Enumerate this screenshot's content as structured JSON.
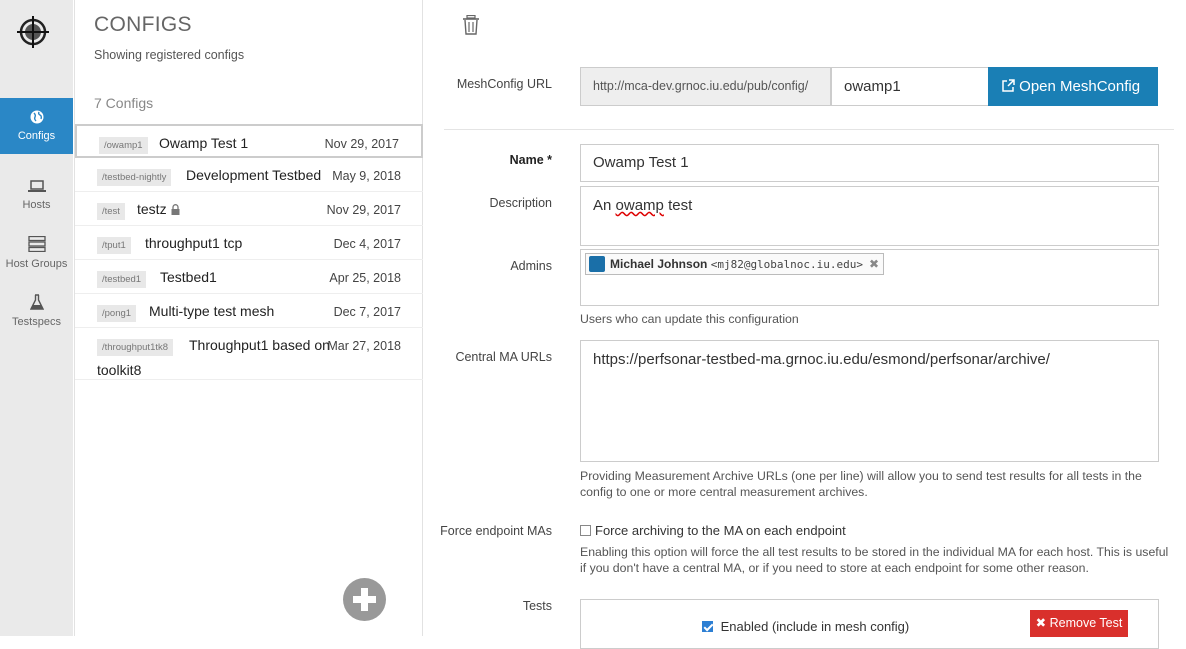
{
  "nav": {
    "items": [
      {
        "label": "Configs",
        "icon": "globe-icon",
        "active": true
      },
      {
        "label": "Hosts",
        "icon": "laptop-icon",
        "active": false
      },
      {
        "label": "Host Groups",
        "icon": "server-icon",
        "active": false
      },
      {
        "label": "Testspecs",
        "icon": "flask-icon",
        "active": false
      }
    ]
  },
  "list": {
    "title": "CONFIGS",
    "subtitle": "Showing registered configs",
    "count": "7 Configs",
    "rows": [
      {
        "tag": "/owamp1",
        "name": "Owamp Test 1",
        "date": "Nov 29, 2017"
      },
      {
        "tag": "/testbed-nightly",
        "name": "Development Testbed",
        "date": "May 9, 2018"
      },
      {
        "tag": "/test",
        "name": "testz",
        "date": "Nov 29, 2017"
      },
      {
        "tag": "/tput1",
        "name": "throughput1 tcp",
        "date": "Dec 4, 2017"
      },
      {
        "tag": "/testbed1",
        "name": "Testbed1",
        "date": "Apr 25, 2018"
      },
      {
        "tag": "/pong1",
        "name": "Multi-type test mesh",
        "date": "Dec 7, 2017"
      },
      {
        "tag": "/throughput1tk8",
        "name": "Throughput1 based on",
        "name2": "toolkit8",
        "date": "Mar 27, 2018"
      }
    ]
  },
  "detail": {
    "meshconfig_label": "MeshConfig URL",
    "url_prefix": "http://mca-dev.grnoc.iu.edu/pub/config/",
    "url_value": "owamp1",
    "open_button": "Open MeshConfig",
    "name_label": "Name *",
    "name_value": "Owamp Test 1",
    "desc_label": "Description",
    "desc_word1": "An",
    "desc_word2": "owamp",
    "desc_word3": "test",
    "admins_label": "Admins",
    "admin_name": "Michael Johnson",
    "admin_email": "<mj82@globalnoc.iu.edu>",
    "admins_help": "Users who can update this configuration",
    "ma_label": "Central MA URLs",
    "ma_value": "https://perfsonar-testbed-ma.grnoc.iu.edu/esmond/perfsonar/archive/",
    "ma_help": "Providing Measurement Archive URLs (one per line) will allow you to send test results for all tests in the config to one or more central measurement archives.",
    "force_label": "Force endpoint MAs",
    "force_checkbox": "Force archiving to the MA on each endpoint",
    "force_help": "Enabling this option will force the all test results to be stored in the individual MA for each host. This is useful if you don't have a central MA, or if you need to store at each endpoint for some other reason.",
    "tests_label": "Tests",
    "enabled_label": "Enabled (include in mesh config)",
    "remove_button": "Remove Test"
  },
  "colors": {
    "accent": "#2a87c6",
    "danger": "#d9302c",
    "button": "#1a7fb5"
  }
}
